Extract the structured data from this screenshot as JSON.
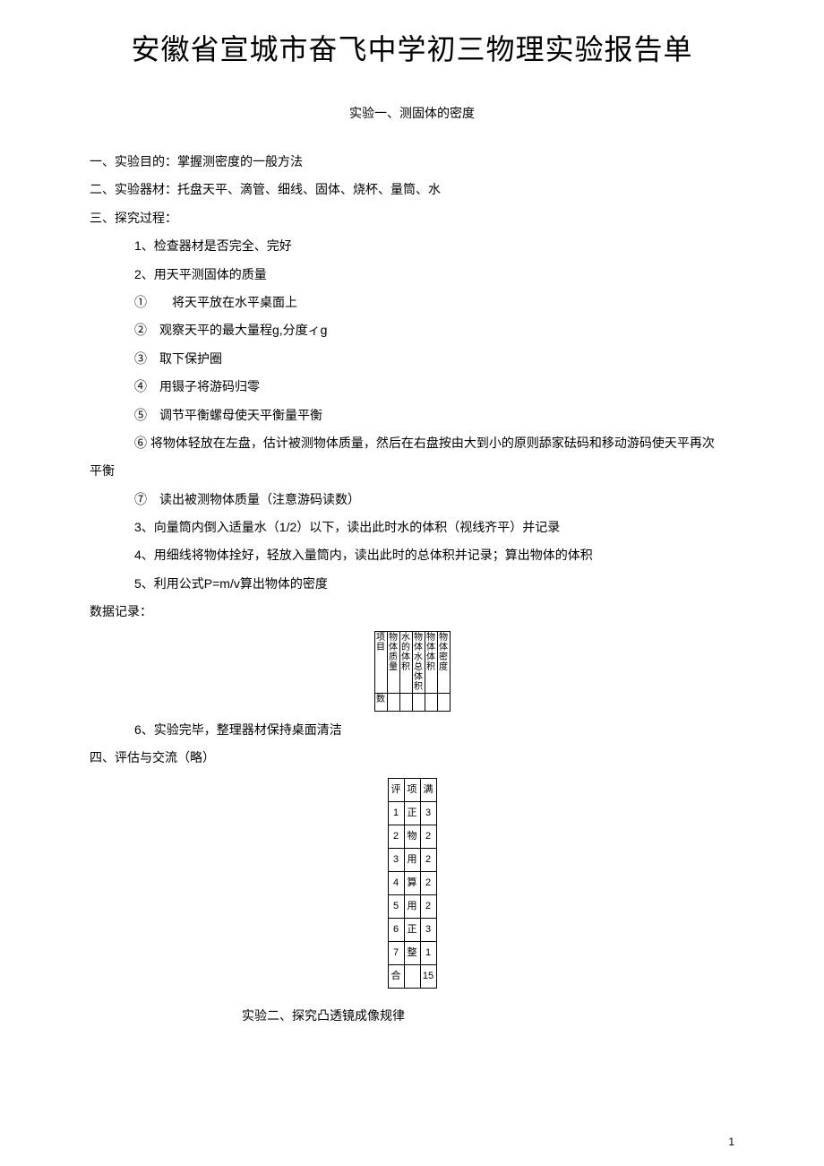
{
  "title": "安徽省宣城市奋飞中学初三物理实验报告单",
  "exp1": {
    "subtitle": "实验一、测固体的密度",
    "s1": "一、实验目的：掌握测密度的一般方法",
    "s2": "二、实验器材：托盘天平、滴管、细线、固体、烧杯、量筒、水",
    "s3": "三、探究过程：",
    "p1": "1、检查器材是否完全、完好",
    "p2": "2、用天平测固体的质量",
    "c1": "①　　将天平放在水平桌面上",
    "c2": "②　观察天平的最大量程g,分度ィg",
    "c3": "③　取下保护圈",
    "c4": "④　用镊子将游码归零",
    "c5": "⑤　调节平衡螺母使天平衡量平衡",
    "c6": "⑥ 将物体轻放在左盘，估计被测物体质量，然后在右盘按由大到小的原则舔家砝码和移动游码使天平再次",
    "c6b": "平衡",
    "c7": "⑦　读出被测物体质量（注意游码读数）",
    "p3": "3、向量筒内倒入适量水（1/2）以下，读出此时水的体积（视线齐平）并记录",
    "p4": "4、用细线将物体拴好，轻放入量筒内，读出此时的总体积并记录；算出物体的体积",
    "p5": "5、利用公式P=m/v算出物体的密度",
    "record": "数据记录：",
    "p6": "6、实验完毕，整理器材保持桌面清洁",
    "s4": "四、评估与交流（略）"
  },
  "table1": {
    "r1c1": "项目",
    "r1c2": "物体质量",
    "r1c3": "水的体积",
    "r1c4": "物体水总体积",
    "r1c5": "物体体积",
    "r1c6": "物体密度",
    "r2c1": "数"
  },
  "table2": {
    "h1": "评",
    "h2": "项",
    "h3": "满",
    "r1c1": "1",
    "r1c2": "正",
    "r1c3": "3",
    "r2c1": "2",
    "r2c2": "物",
    "r2c3": "2",
    "r3c1": "3",
    "r3c2": "用",
    "r3c3": "2",
    "r4c1": "4",
    "r4c2": "算",
    "r4c3": "2",
    "r5c1": "5",
    "r5c2": "用",
    "r5c3": "2",
    "r6c1": "6",
    "r6c2": "正",
    "r6c3": "3",
    "r7c1": "7",
    "r7c2": "整",
    "r7c3": "1",
    "r8c1": "合",
    "r8c2": "",
    "r8c3": "15"
  },
  "exp2": {
    "subtitle": "实验二、探究凸透镜成像规律"
  },
  "pagenum": "1"
}
